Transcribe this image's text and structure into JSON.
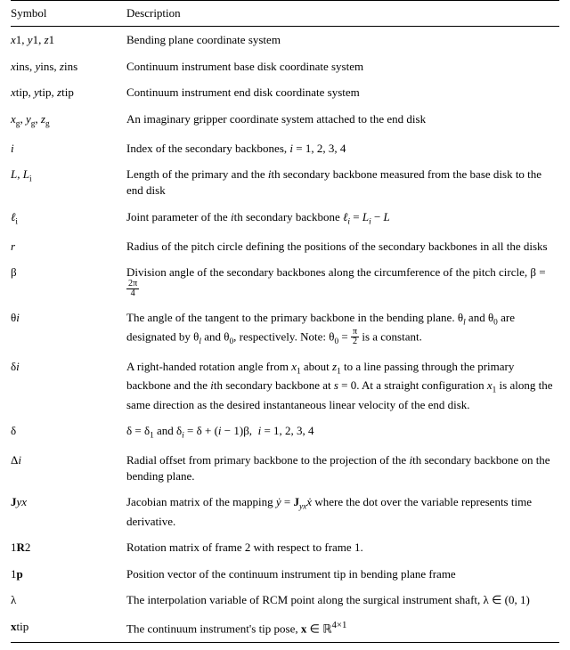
{
  "headers": {
    "symbol": "Symbol",
    "description": "Description"
  },
  "rows": [
    {
      "symbol_html": "<span class='sym'>x</span><span class='sub'>1</span>, <span class='sym'>y</span><span class='sub'>1</span>, <span class='sym'>z</span><span class='sub'>1</span>",
      "desc_html": "Bending plane coordinate system"
    },
    {
      "symbol_html": "<span class='sym'>x</span><span class='sub'>ins</span>, <span class='sym'>y</span><span class='sub'>ins</span>, <span class='sym'>z</span><span class='sub'>ins</span>",
      "desc_html": "Continuum instrument base disk coordinate system"
    },
    {
      "symbol_html": "<span class='sym'>x</span><span class='sub'>tip</span>, <span class='sym'>y</span><span class='sub'>tip</span>, <span class='sym'>z</span><span class='sub'>tip</span>",
      "desc_html": "Continuum instrument end disk coordinate system"
    },
    {
      "symbol_html": "<span class='sym'>x<span class='sub'>g</span></span>, <span class='sym'>y<span class='sub'>g</span></span>, <span class='sym'>z<span class='sub'>g</span></span>",
      "desc_html": "An imaginary gripper coordinate system attached to the end disk"
    },
    {
      "symbol_html": "<span class='sym'>i</span>",
      "desc_html": "Index of the secondary backbones, <span class='sym'>i</span> = 1, 2, 3, 4"
    },
    {
      "symbol_html": "<span class='sym'>L</span>, <span class='sym'>L<span class='sub'>i</span></span>",
      "desc_html": "Length of the primary and the <span class='sym'>i</span>th secondary backbone measured from the base disk to the end disk"
    },
    {
      "symbol_html": "<span class='sym'>&#8467;<span class='sub'>i</span></span>",
      "desc_html": "Joint parameter of the <span class='sym'>i</span>th secondary backbone <span class='sym'>&#8467;<sub>i</sub></span> = <span class='sym'>L<sub>i</sub></span> &minus; <span class='sym'>L</span>"
    },
    {
      "symbol_html": "<span class='sym'>r</span>",
      "desc_html": "Radius of the pitch circle defining the positions of the secondary backbones in all the disks"
    },
    {
      "symbol_html": "<span class='upright'>&beta;</span>",
      "desc_html": "Division angle of the secondary backbones along the circumference of the pitch circle, &beta; = <span class='frac'><span class='num'>2&pi;</span><span class='den'>4</span></span>"
    },
    {
      "symbol_html": "<span class='upright'>&theta;</span><span class='sub sym'>i</span>",
      "desc_html": "The angle of the tangent to the primary backbone in the bending plane. &theta;<sub><i>l</i></sub> and &theta;<sub>0</sub> are designated by &theta;<sub><i>l</i></sub> and &theta;<sub>0</sub>, respectively. Note: &theta;<sub>0</sub> = <span class='frac'><span class='num'>&pi;</span><span class='den'>2</span></span> is a constant."
    },
    {
      "symbol_html": "<span class='upright'>&delta;</span><span class='sub sym'>i</span>",
      "desc_html": "A right-handed rotation angle from <span class='sym'>x</span><sub>1</sub> about <span class='sym'>z</span><sub>1</sub> to a line passing through the primary backbone and the <span class='sym'>i</span>th secondary backbone at <span class='sym'>s</span> = 0. At a straight configuration <span class='sym'>x</span><sub>1</sub> is along the same direction as the desired instantaneous linear velocity of the end disk."
    },
    {
      "symbol_html": "<span class='upright'>&delta;</span>",
      "desc_html": "&delta; = &delta;<sub>1</sub> and &delta;<sub><i>i</i></sub> = &delta; + (<span class='sym'>i</span> &minus; 1)&beta;, &nbsp;<span class='sym'>i</span> = 1, 2, 3, 4"
    },
    {
      "symbol_html": "<span class='upright'>&Delta;</span><span class='sub sym'>i</span>",
      "desc_html": "Radial offset from primary backbone to the projection of the <span class='sym'>i</span>th secondary backbone on the bending plane."
    },
    {
      "symbol_html": "<span class='bold'>J</span><span class='sub sym'>yx</span>",
      "desc_html": "Jacobian matrix of the mapping <span class='sym'>&#7823;</span> = <b>J</b><sub><i>yx</i></sub><span class='sym'>&#7819;</span> where the dot over the variable represents time derivative."
    },
    {
      "symbol_html": "<span class='sup'>1</span><span class='bold'>R</span><span class='sub'>2</span>",
      "desc_html": "Rotation matrix of frame 2 with respect to frame 1."
    },
    {
      "symbol_html": "<span class='sup'>1</span><span class='bold'>p</span>",
      "desc_html": "Position vector of the continuum instrument tip in bending plane frame"
    },
    {
      "symbol_html": "<span class='upright'>&lambda;</span>",
      "desc_html": "The interpolation variable of RCM point along the surgical instrument shaft, &lambda; &isin; (0, 1)"
    },
    {
      "symbol_html": "<span class='bold'>x</span><span class='sub'>tip</span>",
      "desc_html": "The continuum instrument's tip pose, <b>x</b> &isin; <span class='set'>&#8477;</span><sup>4&times;1</sup>"
    }
  ]
}
